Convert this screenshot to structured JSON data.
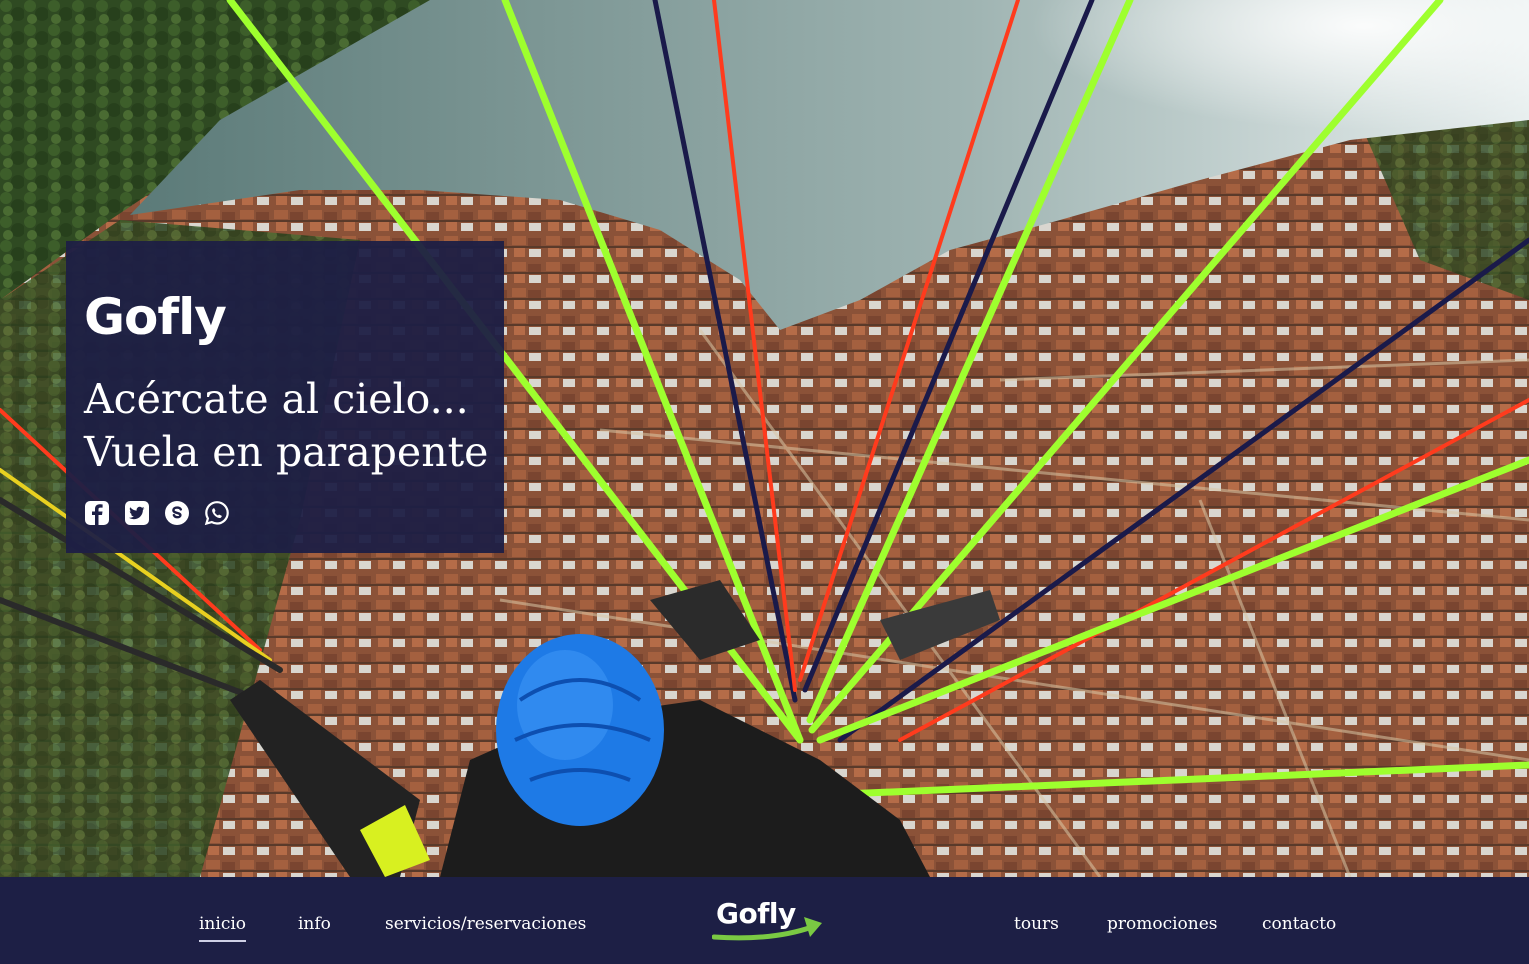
{
  "hero": {
    "card": {
      "logo": "Gofly",
      "tagline_line1": "Acércate al cielo...",
      "tagline_line2": "Vuela en parapente"
    },
    "socials": [
      "facebook-icon",
      "twitter-icon",
      "skype-icon",
      "whatsapp-icon"
    ]
  },
  "nav": {
    "left": [
      "inicio",
      "info",
      "servicios/reservaciones"
    ],
    "brand": "Gofly",
    "right": [
      "tours",
      "promociones",
      "contacto"
    ],
    "active": "inicio"
  },
  "colors": {
    "navy": "#1d1f45",
    "line_green": "#9eff2e",
    "line_red": "#ff3b1d",
    "line_navy": "#1a1a4a",
    "helmet_blue": "#1e7ae6",
    "brand_green": "#7ac943"
  }
}
